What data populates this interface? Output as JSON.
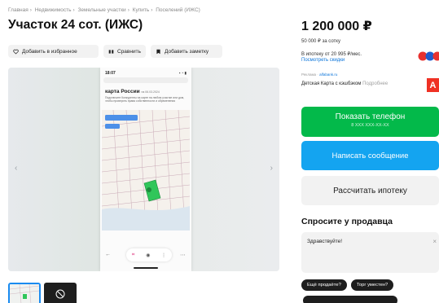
{
  "breadcrumb": [
    "Главная",
    "Недвижимость",
    "Земельные участки",
    "Купить",
    "Поселений (ИЖС)"
  ],
  "listing": {
    "title": "Участок 24 сот. (ИЖС)"
  },
  "actions": {
    "favorite": "Добавить в избранное",
    "compare": "Сравнить",
    "note": "Добавить заметку"
  },
  "phone_screen": {
    "time": "18:07",
    "title_line": "карта России",
    "title_suffix": "на 06.03.2024",
    "body": "Подключите Конкуренты на карте на любом участке или дом, чтобы проверить права собственности и обременения"
  },
  "pricing": {
    "price": "1 200 000 ₽",
    "per_sotka": "50 000 ₽ за сотку",
    "mortgage": "В ипотеку от 20 995 ₽/мес.",
    "discounts_link": "Посмотреть скидки"
  },
  "ad": {
    "label": "Реклама ·",
    "site": "alfabank.ru",
    "text": "Детская Карта с кэшбэком",
    "more": "Подробнее",
    "logo_letter": "А"
  },
  "buttons": {
    "show_phone": "Показать телефон",
    "phone_masked": "8 XXX XXX-XX-XX",
    "write_message": "Написать сообщение",
    "mortgage_calc": "Рассчитать ипотеку"
  },
  "seller_chat": {
    "title": "Спросите у продавца",
    "input_value": "Здравствуйте!",
    "chips": [
      "Ещё продаёте?",
      "Торг уместен?"
    ]
  },
  "colors": {
    "green": "#03b94a",
    "blue": "#14a4f0",
    "link": "#0a74da",
    "alfa_red": "#ef3124"
  }
}
